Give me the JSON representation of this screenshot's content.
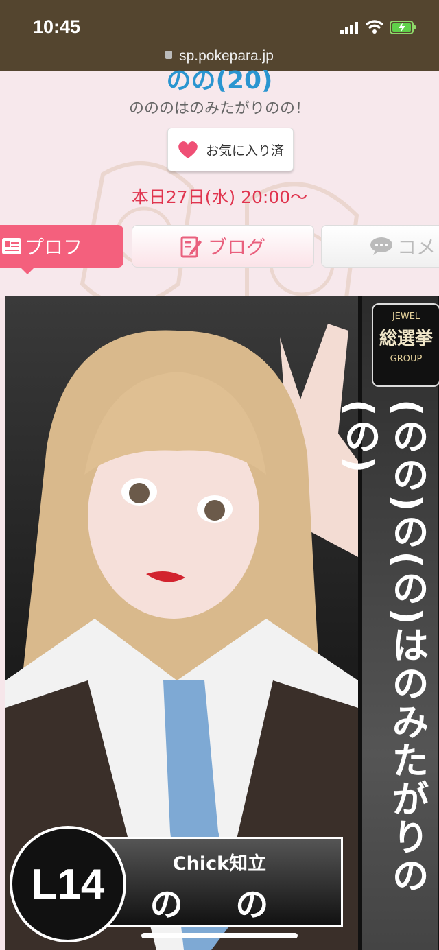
{
  "status": {
    "time": "10:45"
  },
  "browser": {
    "url": "sp.pokepara.jp"
  },
  "profile": {
    "name": "のの(20)",
    "catchphrase": "のののはのみたがりのの！",
    "favorite_label": "お気に入り済",
    "schedule": "本日27日(水) 20:00〜"
  },
  "tabs": [
    {
      "label": "プロフ",
      "icon": "profile-card-icon",
      "active": true
    },
    {
      "label": "ブログ",
      "icon": "edit-icon",
      "active": false
    },
    {
      "label": "コメ",
      "icon": "chat-bubble-icon",
      "active": false
    }
  ],
  "photo": {
    "emblem_top": "JEWEL",
    "emblem_main": "総選挙",
    "emblem_bottom": "GROUP",
    "vertical_text": "(のの)の(の)はのみたがりの(の)",
    "rank_badge": "L14",
    "shop": "Chick知立",
    "cast_name": "の の"
  },
  "colors": {
    "accent": "#f4607d",
    "name": "#2a95d0",
    "schedule": "#e0344e",
    "statusbar": "#54452f"
  }
}
